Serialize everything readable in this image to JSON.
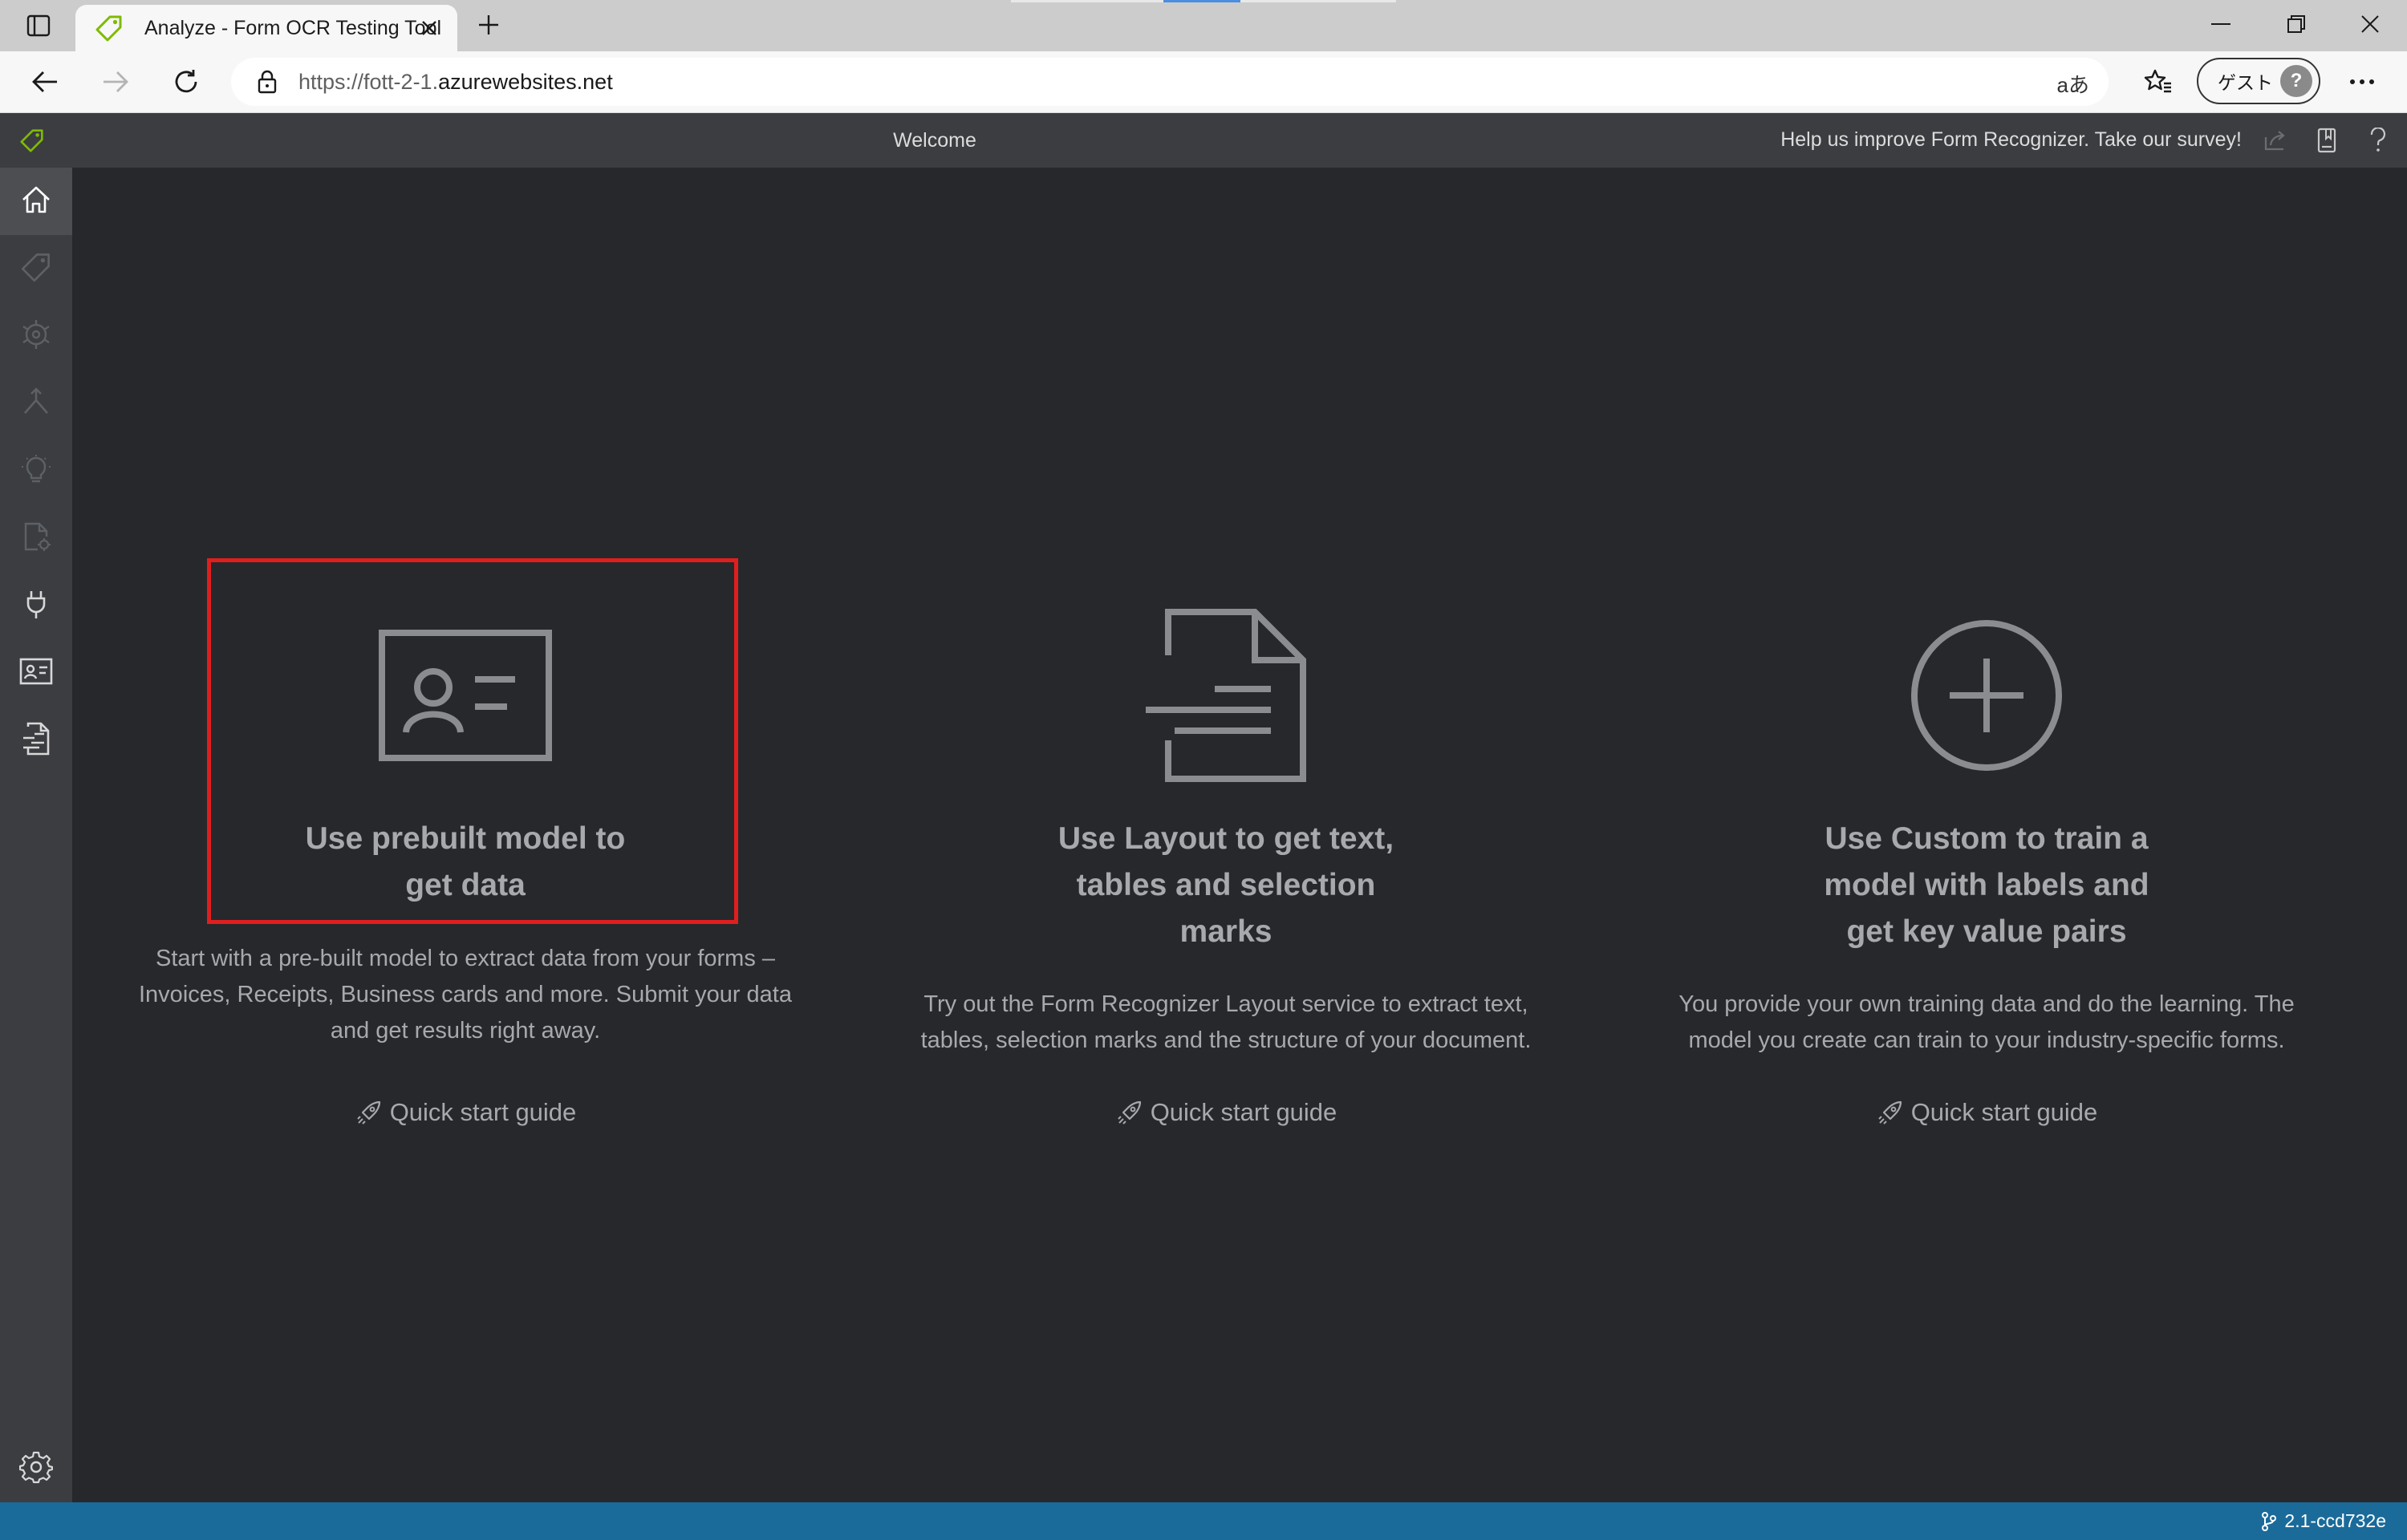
{
  "browser": {
    "tab": {
      "title": "Analyze - Form OCR Testing Tool"
    },
    "address": {
      "url_host": "https://fott-2-1.",
      "url_domain": "azurewebsites.net"
    },
    "read_aloud_label": "aあ",
    "profile": {
      "label": "ゲスト",
      "avatar_glyph": "?"
    }
  },
  "app": {
    "title": "Welcome",
    "survey_link": "Help us improve Form Recognizer. Take our survey!",
    "accent_color": "#7fba00",
    "sidebar": {
      "items": [
        {
          "icon": "home-icon",
          "active": true
        },
        {
          "icon": "tag-icon"
        },
        {
          "icon": "model-icon"
        },
        {
          "icon": "merge-icon"
        },
        {
          "icon": "lightbulb-icon"
        },
        {
          "icon": "document-settings-icon"
        },
        {
          "icon": "plug-icon"
        },
        {
          "icon": "id-card-icon"
        },
        {
          "icon": "layout-document-icon"
        },
        {
          "icon": "gear-icon"
        }
      ]
    },
    "cards": [
      {
        "icon": "contact-card-icon",
        "title_line1": "Use prebuilt model to",
        "title_line2": "get data",
        "title_line3": "",
        "desc_line1": "Start with a pre-built model to extract data from your forms –",
        "desc_line2": "Invoices, Receipts, Business cards and more. Submit your data",
        "desc_line3": "and get results right away.",
        "quick_start": "Quick start guide",
        "highlighted": true
      },
      {
        "icon": "text-document-icon",
        "title_line1": "Use Layout to get text,",
        "title_line2": "tables and selection",
        "title_line3": "marks",
        "desc_line1": "Try out the Form Recognizer Layout service to extract text,",
        "desc_line2": "tables, selection marks and the structure of your document.",
        "quick_start": "Quick start guide"
      },
      {
        "icon": "add-circle-icon",
        "title_line1": "Use Custom to train a",
        "title_line2": "model with labels and",
        "title_line3": "get key value pairs",
        "desc_line1": "You provide your own training data and do the learning. The",
        "desc_line2": "model you create can train to your industry-specific forms.",
        "quick_start": "Quick start guide"
      }
    ],
    "status": {
      "version": "2.1-ccd732e",
      "bar_color": "#1a6b9a"
    }
  }
}
